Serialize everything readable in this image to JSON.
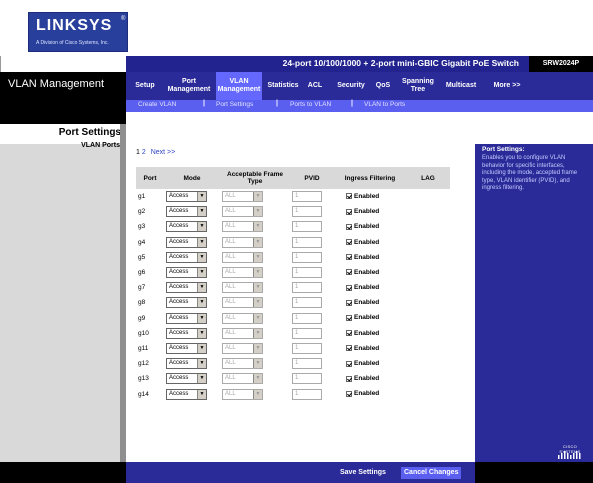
{
  "brand": {
    "logo_text": "LINKSYS",
    "logo_registered": "®",
    "logo_subtext": "A Division of Cisco Systems, Inc."
  },
  "product": {
    "name": "24-port 10/100/1000 + 2-port mini-GBIC Gigabit PoE Switch",
    "model": "SRW2024P"
  },
  "section_title": "VLAN Management",
  "nav": [
    {
      "label": "Setup",
      "active": false
    },
    {
      "label": "Port\nManagement",
      "active": false
    },
    {
      "label": "VLAN\nManagement",
      "active": true
    },
    {
      "label": "Statistics",
      "active": false
    },
    {
      "label": "ACL",
      "active": false
    },
    {
      "label": "Security",
      "active": false
    },
    {
      "label": "QoS",
      "active": false
    },
    {
      "label": "Spanning\nTree",
      "active": false
    },
    {
      "label": "Multicast",
      "active": false
    },
    {
      "label": "More >>",
      "active": false
    }
  ],
  "subnav": [
    "Create VLAN",
    "Port Settings",
    "Ports to VLAN",
    "VLAN to Ports"
  ],
  "subnav_separator": "|",
  "left_panel": {
    "title": "Port Settings",
    "item": "VLAN Ports"
  },
  "pagination": {
    "current": "1",
    "page2": "2",
    "next": "Next >>"
  },
  "table": {
    "headers": [
      "Port",
      "Mode",
      "Acceptable Frame Type",
      "PVID",
      "Ingress Filtering",
      "LAG"
    ],
    "rows": [
      {
        "port": "g1",
        "mode": "Access",
        "frame": "ALL",
        "pvid": "1",
        "ingress": "Enabled",
        "lag": ""
      },
      {
        "port": "g2",
        "mode": "Access",
        "frame": "ALL",
        "pvid": "1",
        "ingress": "Enabled",
        "lag": ""
      },
      {
        "port": "g3",
        "mode": "Access",
        "frame": "ALL",
        "pvid": "1",
        "ingress": "Enabled",
        "lag": ""
      },
      {
        "port": "g4",
        "mode": "Access",
        "frame": "ALL",
        "pvid": "1",
        "ingress": "Enabled",
        "lag": ""
      },
      {
        "port": "g5",
        "mode": "Access",
        "frame": "ALL",
        "pvid": "1",
        "ingress": "Enabled",
        "lag": ""
      },
      {
        "port": "g6",
        "mode": "Access",
        "frame": "ALL",
        "pvid": "1",
        "ingress": "Enabled",
        "lag": ""
      },
      {
        "port": "g7",
        "mode": "Access",
        "frame": "ALL",
        "pvid": "1",
        "ingress": "Enabled",
        "lag": ""
      },
      {
        "port": "g8",
        "mode": "Access",
        "frame": "ALL",
        "pvid": "1",
        "ingress": "Enabled",
        "lag": ""
      },
      {
        "port": "g9",
        "mode": "Access",
        "frame": "ALL",
        "pvid": "1",
        "ingress": "Enabled",
        "lag": ""
      },
      {
        "port": "g10",
        "mode": "Access",
        "frame": "ALL",
        "pvid": "1",
        "ingress": "Enabled",
        "lag": ""
      },
      {
        "port": "g11",
        "mode": "Access",
        "frame": "ALL",
        "pvid": "1",
        "ingress": "Enabled",
        "lag": ""
      },
      {
        "port": "g12",
        "mode": "Access",
        "frame": "ALL",
        "pvid": "1",
        "ingress": "Enabled",
        "lag": ""
      },
      {
        "port": "g13",
        "mode": "Access",
        "frame": "ALL",
        "pvid": "1",
        "ingress": "Enabled",
        "lag": ""
      },
      {
        "port": "g14",
        "mode": "Access",
        "frame": "ALL",
        "pvid": "1",
        "ingress": "Enabled",
        "lag": ""
      }
    ]
  },
  "help": {
    "title": "Port Settings:",
    "body": "Enables you to configure VLAN behavior for specific interfaces, including the mode, accepted frame type, VLAN identifier (PVID), and ingress filtering."
  },
  "cisco_logo_text": "CISCO SYSTEMS",
  "buttons": {
    "save": "Save Settings",
    "cancel": "Cancel Changes"
  },
  "colors": {
    "nav_blue": "#2a2a98",
    "active_tab": "#6468ff",
    "subnav": "#5b5ff0",
    "brand_blue": "#283f9c"
  },
  "icons": {
    "dropdown": "chevron-down-icon",
    "checkbox": "checkbox-checked-icon",
    "cisco": "cisco-bridge-icon"
  }
}
